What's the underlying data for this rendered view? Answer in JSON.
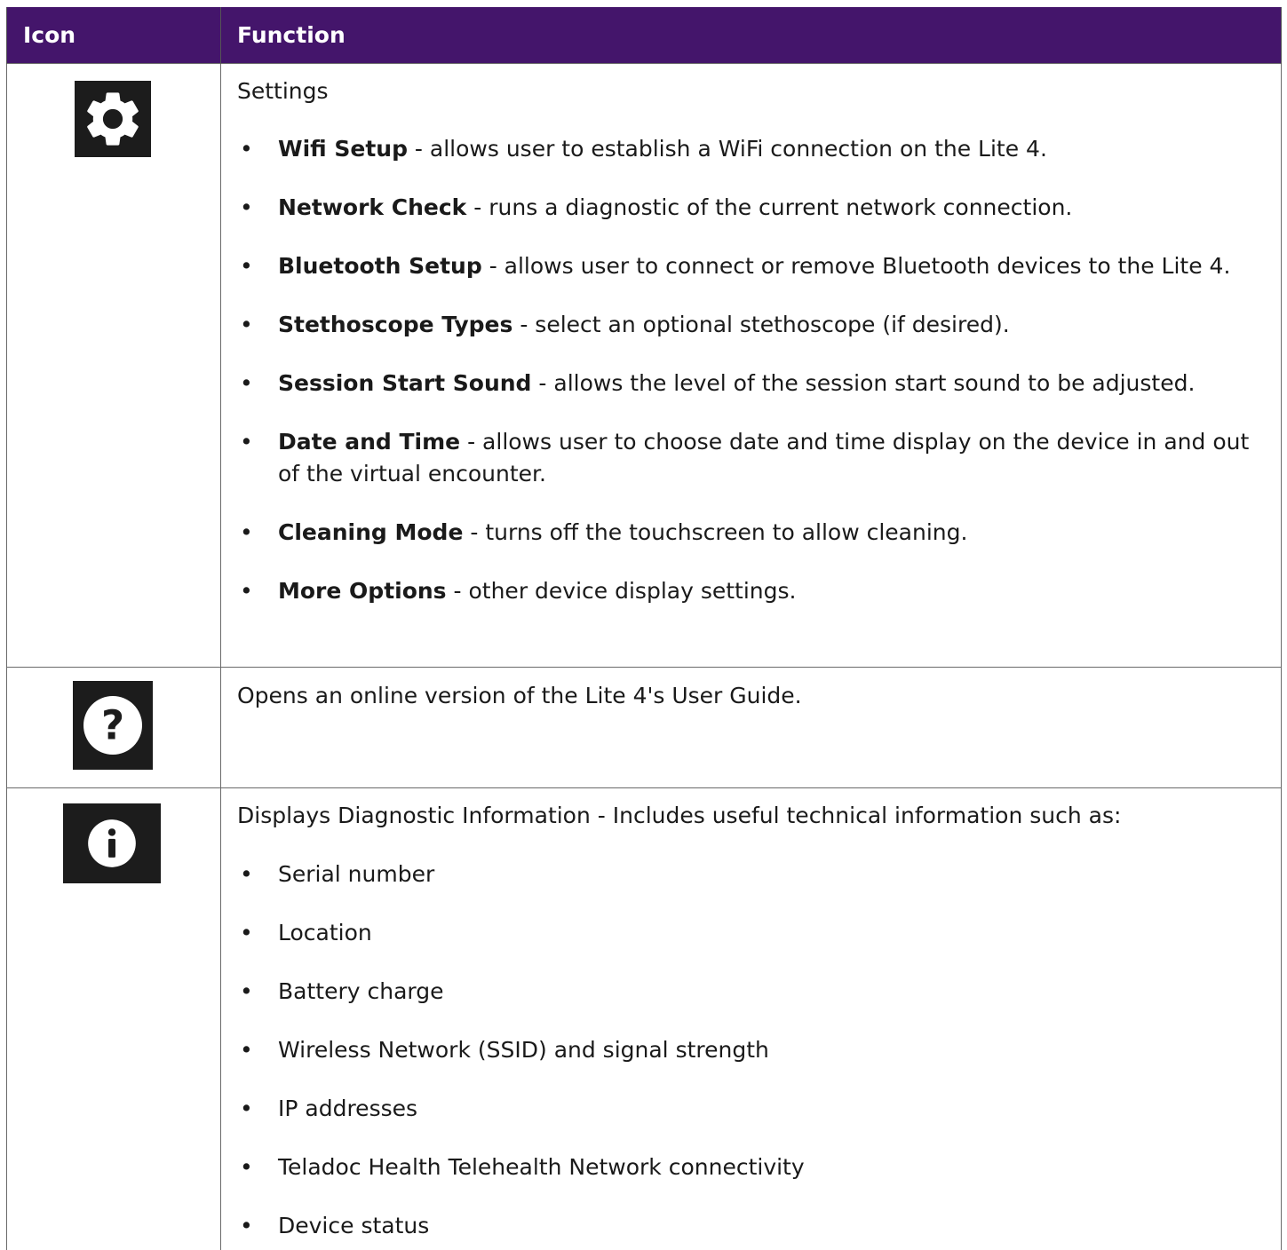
{
  "table": {
    "headers": {
      "icon": "Icon",
      "function": "Function"
    }
  },
  "settings": {
    "icon_name": "gear-icon",
    "lead": "Settings",
    "items": [
      {
        "term": "Wifi Setup",
        "desc": " - allows user to establish a WiFi connection on the Lite 4."
      },
      {
        "term": "Network Check",
        "desc": " - runs a diagnostic of the current network connection."
      },
      {
        "term": "Bluetooth Setup",
        "desc": " - allows user to connect or remove Bluetooth devices to the Lite 4."
      },
      {
        "term": "Stethoscope Types",
        "desc": " - select an optional stethoscope (if desired)."
      },
      {
        "term": "Session Start Sound",
        "desc": " - allows the level of the session start sound to be adjusted."
      },
      {
        "term": "Date and Time",
        "desc": " - allows user to choose date and time display on the device in and out of the virtual encounter."
      },
      {
        "term": "Cleaning Mode",
        "desc": " - turns off the touchscreen to allow cleaning."
      },
      {
        "term": "More Options",
        "desc": " - other device display settings."
      }
    ]
  },
  "help": {
    "icon_name": "help-question-icon",
    "lead": "Opens an online version of the Lite 4's User Guide."
  },
  "info": {
    "icon_name": "info-icon",
    "lead": "Displays Diagnostic Information - Includes useful technical information such as:",
    "items": [
      "Serial number",
      "Location",
      "Battery charge",
      "Wireless Network (SSID) and signal strength",
      "IP addresses",
      "Teladoc Health Telehealth Network connectivity",
      "Device status"
    ]
  },
  "colors": {
    "header_bg": "#44156b",
    "header_text": "#ffffff",
    "icon_bg": "#1c1c1c"
  }
}
